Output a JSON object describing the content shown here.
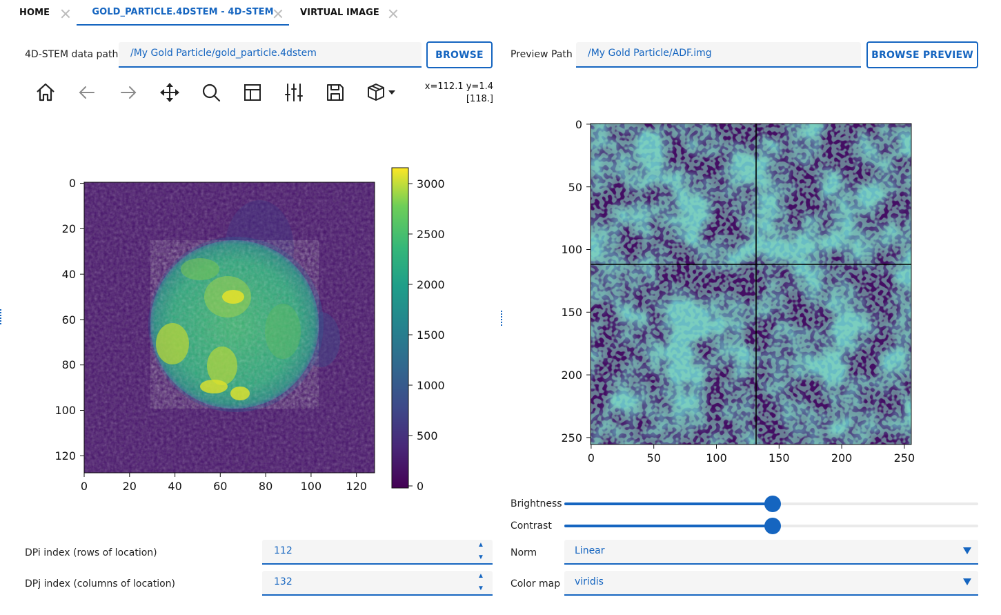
{
  "tabs": [
    {
      "label": "HOME",
      "active": false
    },
    {
      "label": "GOLD_PARTICLE.4DSTEM - 4D-STEM",
      "active": true
    },
    {
      "label": "VIRTUAL IMAGE",
      "active": false
    }
  ],
  "data_path": {
    "label": "4D-STEM data path",
    "value": "/My Gold Particle/gold_particle.4dstem",
    "button": "BROWSE"
  },
  "preview_path": {
    "label": "Preview Path",
    "value": "/My Gold Particle/ADF.img",
    "button": "BROWSE PREVIEW"
  },
  "toolbar": {
    "icons": [
      "home-icon",
      "back-icon",
      "forward-icon",
      "pan-icon",
      "zoom-icon",
      "subplots-icon",
      "adjust-icon",
      "save-icon",
      "3d-cube-icon"
    ],
    "coord_readout": "x=112.1 y=1.4",
    "value_readout": "[118.]"
  },
  "left_plot": {
    "colormap": "viridis",
    "x_ticks": [
      "0",
      "20",
      "40",
      "60",
      "80",
      "100",
      "120"
    ],
    "y_ticks": [
      "0",
      "20",
      "40",
      "60",
      "80",
      "100",
      "120"
    ],
    "x_range": [
      0,
      128
    ],
    "y_range": [
      0,
      128
    ],
    "colorbar_ticks": [
      "0",
      "500",
      "1000",
      "1500",
      "2000",
      "2500",
      "3000"
    ],
    "colorbar_range": [
      0,
      3150
    ]
  },
  "right_plot": {
    "colormap": "viridis",
    "x_ticks": [
      "0",
      "50",
      "100",
      "150",
      "200",
      "250"
    ],
    "y_ticks": [
      "0",
      "50",
      "100",
      "150",
      "200",
      "250"
    ],
    "x_range": [
      0,
      256
    ],
    "y_range": [
      0,
      256
    ],
    "crosshair": {
      "x": 132,
      "y": 112
    }
  },
  "controls": {
    "brightness": {
      "label": "Brightness",
      "value": 0.5
    },
    "contrast": {
      "label": "Contrast",
      "value": 0.5
    },
    "norm": {
      "label": "Norm",
      "value": "Linear"
    },
    "colormap": {
      "label": "Color map",
      "value": "viridis"
    },
    "dpi": {
      "label": "DPi index (rows of location)",
      "value": "112"
    },
    "dpj": {
      "label": "DPj index (columns of location)",
      "value": "132"
    }
  },
  "colors": {
    "accent": "#1565c0",
    "field_bg": "#f5f5f5"
  }
}
